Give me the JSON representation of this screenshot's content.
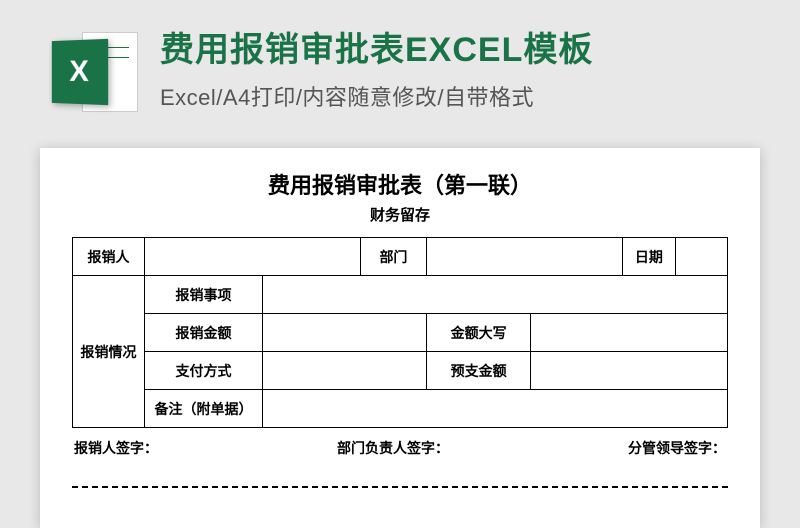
{
  "header": {
    "title": "费用报销审批表EXCEL模板",
    "subtitle": "Excel/A4打印/内容随意修改/自带格式",
    "icon_letter": "X"
  },
  "form": {
    "title": "费用报销审批表（第一联）",
    "subtitle": "财务留存",
    "row1": {
      "applicant_label": "报销人",
      "dept_label": "部门",
      "date_label": "日期"
    },
    "detail_section_label": "报销情况",
    "details": {
      "r1_label": "报销事项",
      "r2_label": "报销金额",
      "r2_label2": "金额大写",
      "r3_label": "支付方式",
      "r3_label2": "预支金额",
      "r4_label": "备注（附单据）"
    },
    "signatures": {
      "applicant": "报销人签字：",
      "dept_head": "部门负责人签字：",
      "leader": "分管领导签字："
    }
  }
}
